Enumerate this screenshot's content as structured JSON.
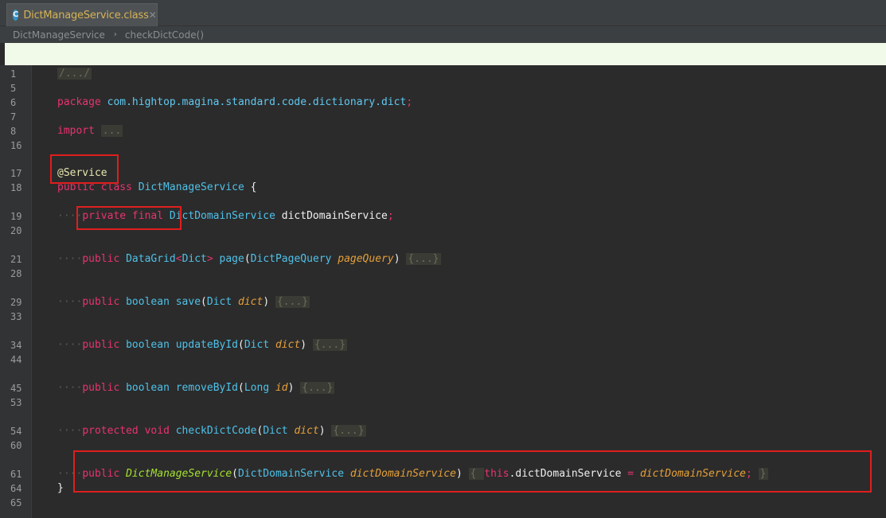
{
  "tab": {
    "icon_letter": "C",
    "label": "DictManageService.class",
    "close": "✕"
  },
  "breadcrumb": {
    "items": [
      "DictManageService",
      "checkDictCode()"
    ],
    "separator": "›"
  },
  "colors": {
    "keyword": "#e9336d",
    "type": "#4fc1e9",
    "function": "#a6e22e",
    "parameter": "#e6a03a",
    "highlight_box": "#e01e1e"
  },
  "code": {
    "lines": [
      {
        "num": "1",
        "parts": [
          [
            "fold",
            "/.../"
          ]
        ]
      },
      {
        "num": "5",
        "parts": []
      },
      {
        "num": "6",
        "parts": [
          [
            "kw",
            "package "
          ],
          [
            "pkg",
            "com.hightop.magina.standard.code.dictionary.dict"
          ],
          [
            "kw",
            ";"
          ]
        ]
      },
      {
        "num": "7",
        "parts": []
      },
      {
        "num": "8",
        "parts": [
          [
            "kw",
            "import "
          ],
          [
            "fold",
            "..."
          ]
        ]
      },
      {
        "num": "16",
        "parts": []
      },
      {
        "num": "17",
        "parts": [
          [
            "annot",
            "@Service"
          ]
        ]
      },
      {
        "num": "18",
        "parts": [
          [
            "kw",
            "public class "
          ],
          [
            "ty",
            "DictManageService "
          ],
          [
            "white",
            "{"
          ]
        ]
      },
      {
        "num": "19",
        "parts": [
          [
            "dots",
            "····"
          ],
          [
            "kw",
            "private final "
          ],
          [
            "ty",
            "DictDomainService "
          ],
          [
            "white",
            "dictDomainService"
          ],
          [
            "kw",
            ";"
          ]
        ]
      },
      {
        "num": "20",
        "parts": []
      },
      {
        "num": "21",
        "parts": [
          [
            "dots",
            "····"
          ],
          [
            "kw",
            "public "
          ],
          [
            "ty",
            "DataGrid"
          ],
          [
            "kw",
            "<"
          ],
          [
            "ty",
            "Dict"
          ],
          [
            "kw",
            "> "
          ],
          [
            "ty",
            "page"
          ],
          [
            "white",
            "("
          ],
          [
            "ty",
            "DictPageQuery "
          ],
          [
            "param",
            "pageQuery"
          ],
          [
            "white",
            ") "
          ],
          [
            "fold",
            "{...}"
          ]
        ]
      },
      {
        "num": "28",
        "parts": []
      },
      {
        "num": "29",
        "parts": [
          [
            "dots",
            "····"
          ],
          [
            "kw",
            "public "
          ],
          [
            "ty",
            "boolean "
          ],
          [
            "ty",
            "save"
          ],
          [
            "white",
            "("
          ],
          [
            "ty",
            "Dict "
          ],
          [
            "param",
            "dict"
          ],
          [
            "white",
            ") "
          ],
          [
            "fold",
            "{...}"
          ]
        ]
      },
      {
        "num": "33",
        "parts": []
      },
      {
        "num": "34",
        "parts": [
          [
            "dots",
            "····"
          ],
          [
            "kw",
            "public "
          ],
          [
            "ty",
            "boolean "
          ],
          [
            "ty",
            "updateById"
          ],
          [
            "white",
            "("
          ],
          [
            "ty",
            "Dict "
          ],
          [
            "param",
            "dict"
          ],
          [
            "white",
            ") "
          ],
          [
            "fold",
            "{...}"
          ]
        ]
      },
      {
        "num": "44",
        "parts": []
      },
      {
        "num": "45",
        "parts": [
          [
            "dots",
            "····"
          ],
          [
            "kw",
            "public "
          ],
          [
            "ty",
            "boolean "
          ],
          [
            "ty",
            "removeById"
          ],
          [
            "white",
            "("
          ],
          [
            "ty",
            "Long "
          ],
          [
            "param",
            "id"
          ],
          [
            "white",
            ") "
          ],
          [
            "fold",
            "{...}"
          ]
        ]
      },
      {
        "num": "53",
        "parts": []
      },
      {
        "num": "54",
        "parts": [
          [
            "dots",
            "····"
          ],
          [
            "kw",
            "protected "
          ],
          [
            "kw",
            "void "
          ],
          [
            "ty",
            "checkDictCode"
          ],
          [
            "white",
            "("
          ],
          [
            "ty",
            "Dict "
          ],
          [
            "param",
            "dict"
          ],
          [
            "white",
            ") "
          ],
          [
            "fold",
            "{...}"
          ]
        ]
      },
      {
        "num": "60",
        "parts": []
      },
      {
        "num": "61",
        "parts": [
          [
            "dots",
            "····"
          ],
          [
            "kw",
            "public "
          ],
          [
            "fn-it",
            "DictManageService"
          ],
          [
            "white",
            "("
          ],
          [
            "ty",
            "DictDomainService "
          ],
          [
            "param",
            "dictDomainService"
          ],
          [
            "white",
            ") "
          ],
          [
            "fold",
            "{ "
          ],
          [
            "kw",
            "this"
          ],
          [
            "white",
            ".dictDomainService "
          ],
          [
            "kw",
            "= "
          ],
          [
            "param",
            "dictDomainService"
          ],
          [
            "kw",
            "; "
          ],
          [
            "fold",
            "}"
          ]
        ]
      },
      {
        "num": "64",
        "parts": [
          [
            "white",
            "}"
          ]
        ]
      },
      {
        "num": "65",
        "parts": []
      }
    ]
  }
}
